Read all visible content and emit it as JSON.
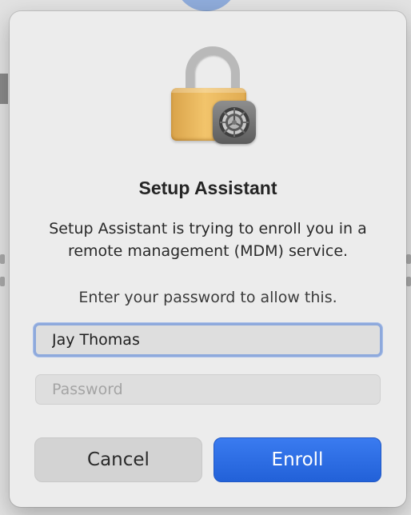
{
  "dialog": {
    "title": "Setup Assistant",
    "message": "Setup Assistant is trying to enroll you in a remote management (MDM) service.",
    "prompt": "Enter your password to allow this.",
    "icon": "lock-with-settings-gear-icon"
  },
  "form": {
    "username_value": "Jay Thomas",
    "password_placeholder": "Password",
    "password_value": ""
  },
  "buttons": {
    "cancel_label": "Cancel",
    "enroll_label": "Enroll"
  },
  "colors": {
    "accent": "#2a6ae3",
    "focus_ring": "#8ea9dc"
  }
}
